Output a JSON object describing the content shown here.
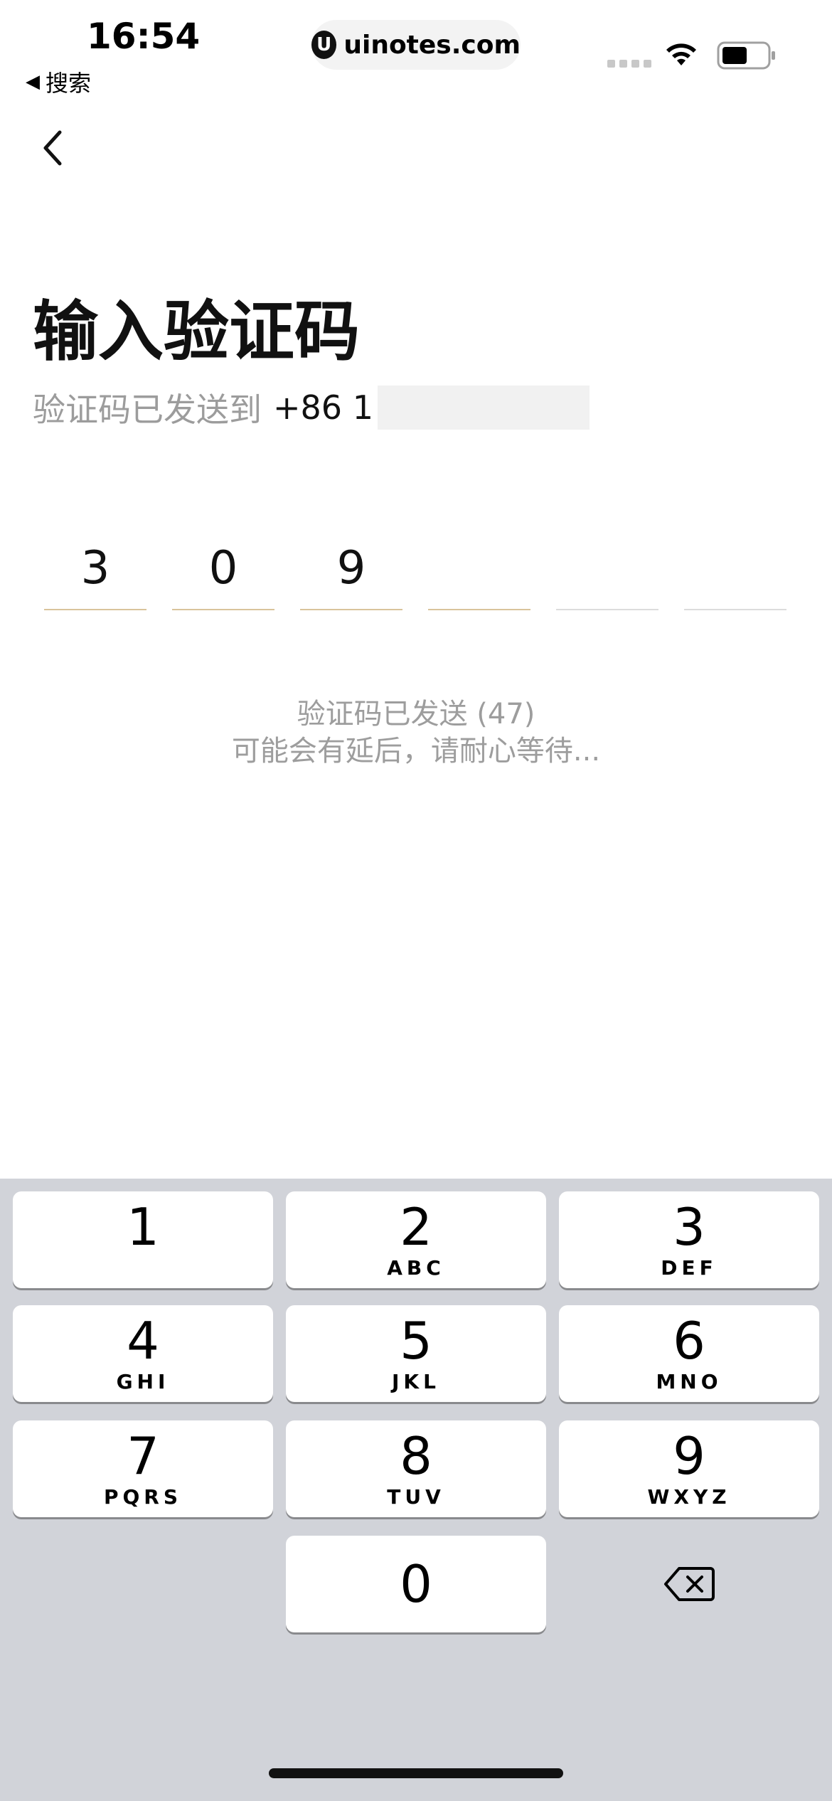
{
  "status_bar": {
    "time": "16:54",
    "back_app_label": "搜索",
    "url": "uinotes.com",
    "url_logo": "U"
  },
  "page": {
    "title": "输入验证码",
    "subtitle_label": "验证码已发送到",
    "phone_prefix": "+86 1",
    "code_digits": [
      "3",
      "0",
      "9",
      "",
      "",
      ""
    ],
    "info_line1": "验证码已发送 (47)",
    "info_line2": "可能会有延后，请耐心等待..."
  },
  "keyboard": {
    "keys": [
      {
        "num": "1",
        "letters": ""
      },
      {
        "num": "2",
        "letters": "ABC"
      },
      {
        "num": "3",
        "letters": "DEF"
      },
      {
        "num": "4",
        "letters": "GHI"
      },
      {
        "num": "5",
        "letters": "JKL"
      },
      {
        "num": "6",
        "letters": "MNO"
      },
      {
        "num": "7",
        "letters": "PQRS"
      },
      {
        "num": "8",
        "letters": "TUV"
      },
      {
        "num": "9",
        "letters": "WXYZ"
      },
      {
        "num": "0",
        "letters": ""
      }
    ]
  },
  "colors": {
    "accent_underline": "#d9c49b",
    "keyboard_bg": "#d1d3d9",
    "muted_text": "#9c9c9c"
  },
  "icons": {
    "nav_back": "chevron-left-icon",
    "delete": "backspace-icon",
    "wifi": "wifi-icon",
    "battery": "battery-icon"
  }
}
